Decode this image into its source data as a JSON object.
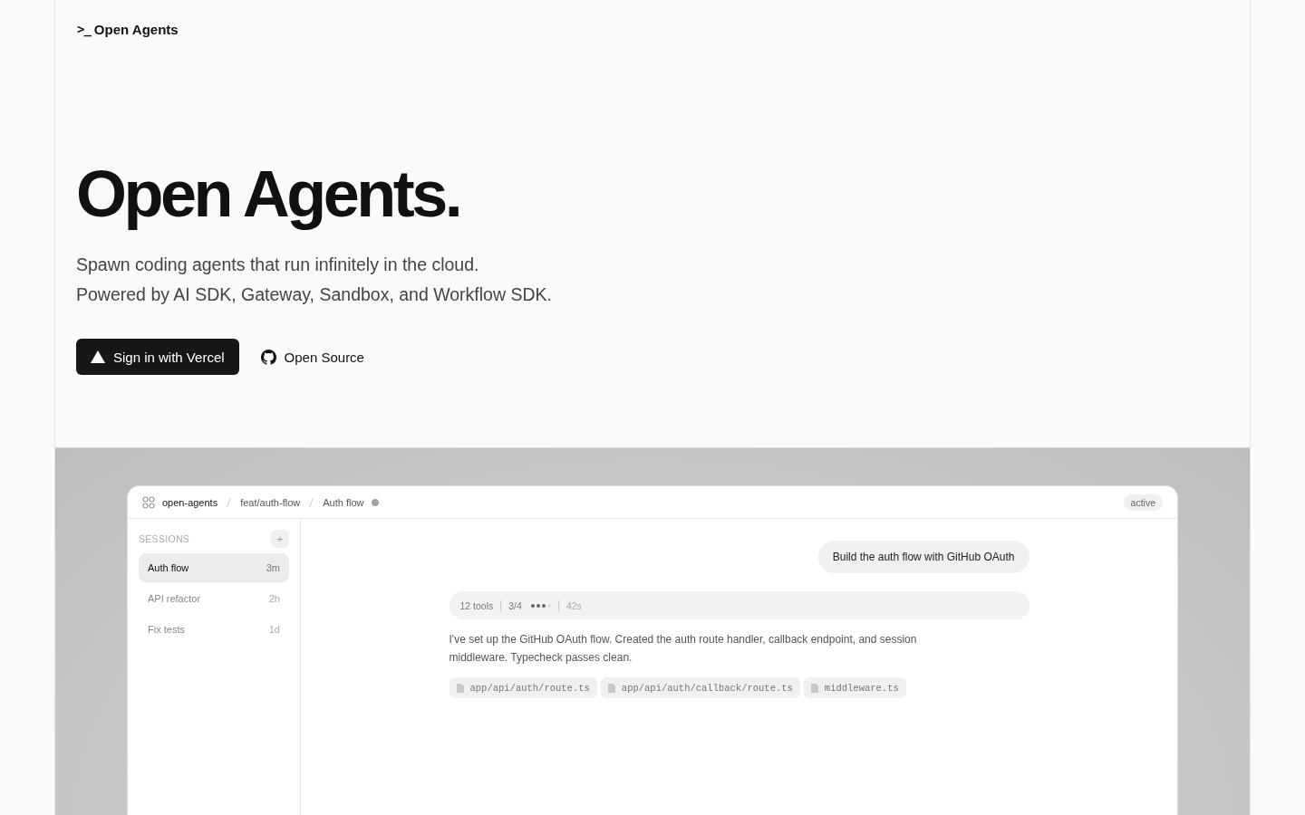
{
  "header": {
    "logo_prompt": ">_",
    "logo_text": "Open Agents"
  },
  "hero": {
    "title": "Open Agents.",
    "subtitle_lines": [
      "Spawn coding agents that run infinitely in the cloud.",
      "Powered by AI SDK, Gateway, Sandbox, and Workflow SDK."
    ],
    "buttons": [
      {
        "kind": "primary",
        "label": "Sign in with Vercel"
      },
      {
        "kind": "github",
        "label": "Open Source"
      }
    ]
  },
  "app": {
    "breadcrumb": [
      "open-agents",
      "feat/auth-flow",
      "Auth flow"
    ],
    "status": "active",
    "sidebar": {
      "heading": "SESSIONS",
      "add": "+",
      "items": [
        {
          "label": "Auth flow",
          "time": "3m",
          "selected": true
        },
        {
          "label": "API refactor",
          "time": "2h",
          "selected": false
        },
        {
          "label": "Fix tests",
          "time": "1d",
          "selected": false
        }
      ]
    },
    "chat": {
      "user_message": "Build the auth flow with GitHub OAuth",
      "tool_bar": {
        "tools": "12 tools",
        "steps": "3/4",
        "dots": [
          {
            "done": true
          },
          {
            "done": true
          },
          {
            "done": true
          },
          {
            "done": false
          }
        ],
        "duration": "42s"
      },
      "reply": "I've set up the GitHub OAuth flow. Created the auth route handler, callback endpoint, and session middleware. Typecheck passes clean.",
      "files": [
        "app/api/auth/route.ts",
        "app/api/auth/callback/route.ts",
        "middleware.ts"
      ]
    }
  }
}
